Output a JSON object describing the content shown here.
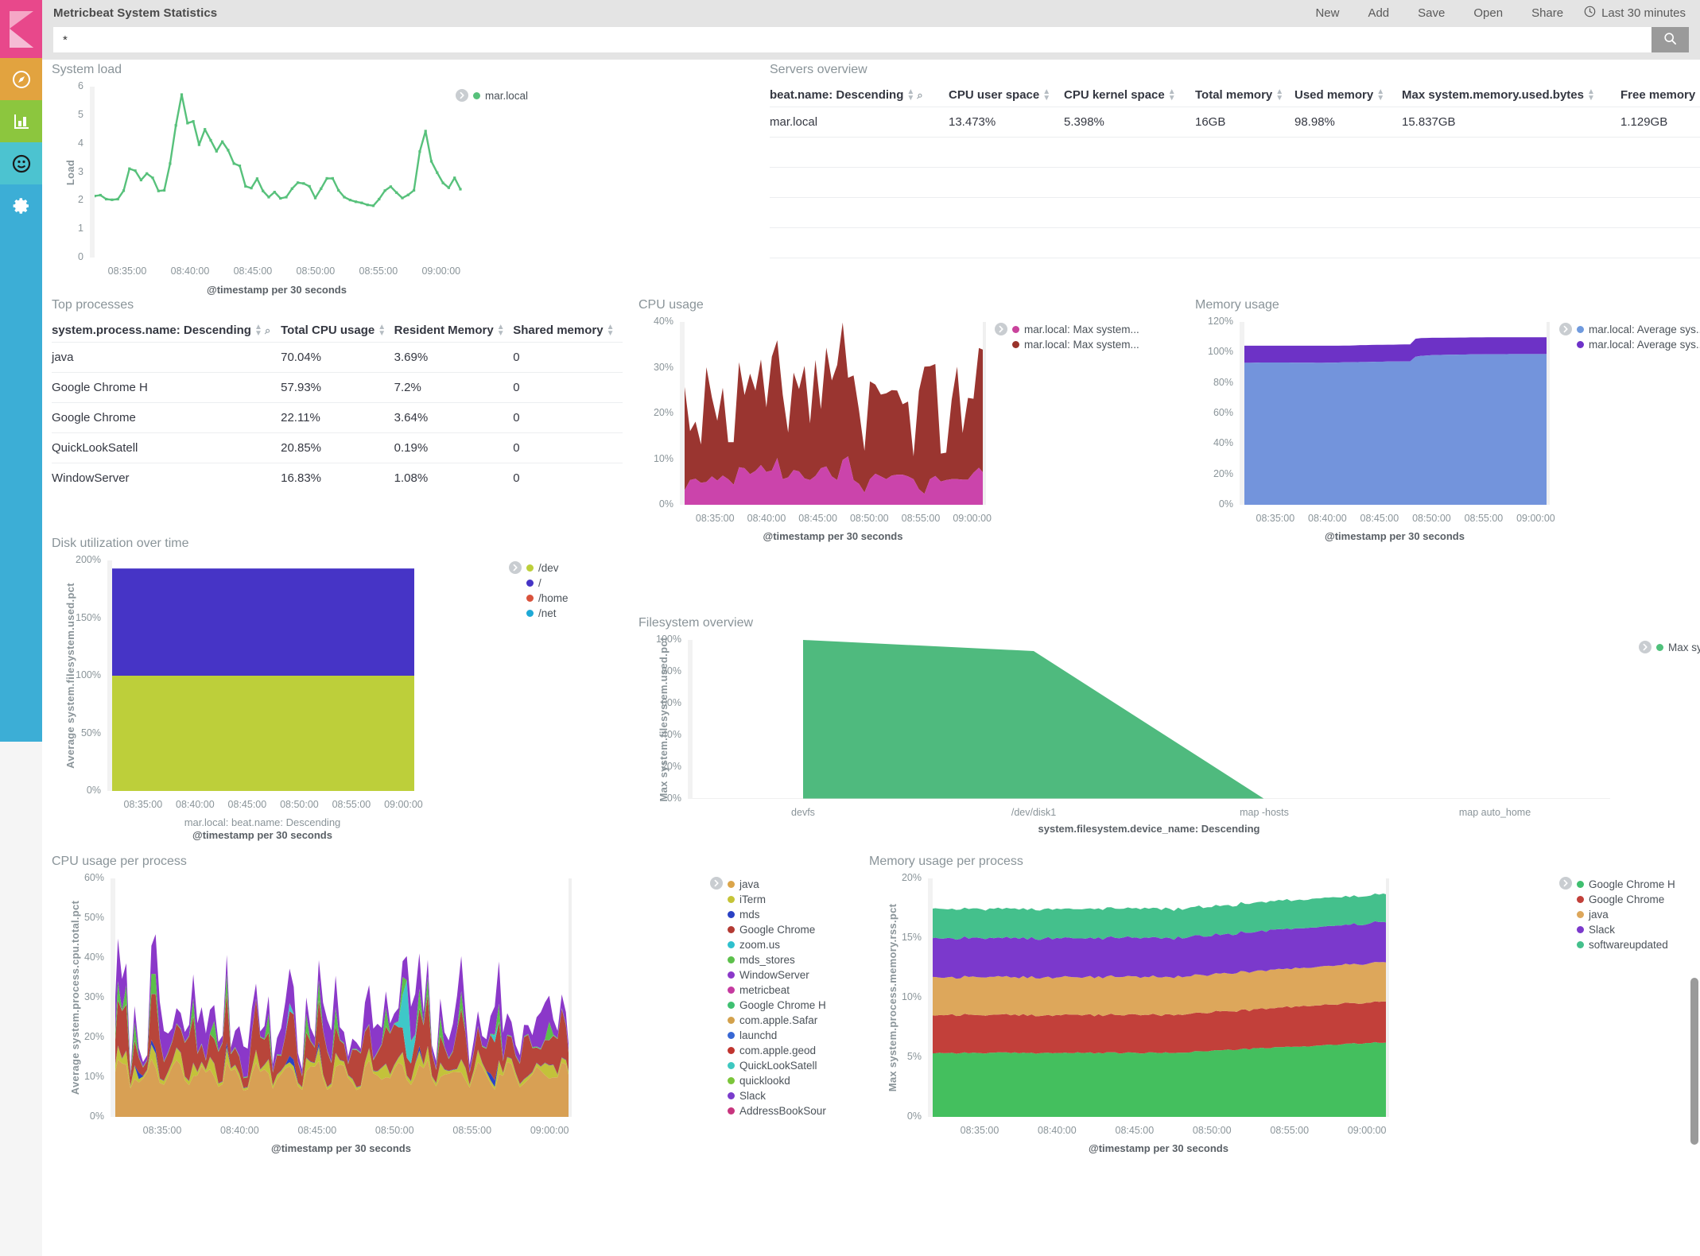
{
  "app": {
    "title": "Metricbeat System Statistics",
    "nav": [
      "New",
      "Add",
      "Save",
      "Open",
      "Share"
    ],
    "time_range": "Last 30 minutes",
    "clock_icon": "clock-icon",
    "search_icon": "search-icon"
  },
  "query": {
    "value": "*",
    "placeholder": ""
  },
  "sidebar": {
    "items": [
      {
        "name": "kibana-logo",
        "icon": "kibana-logo-icon",
        "color": "#e8488b"
      },
      {
        "name": "discover",
        "icon": "compass-icon",
        "color": "#e2a33f"
      },
      {
        "name": "visualize",
        "icon": "bar-chart-icon",
        "color": "#8cc63e"
      },
      {
        "name": "dashboard",
        "icon": "dashboard-icon",
        "color": "#4cc3d0"
      },
      {
        "name": "management",
        "icon": "gear-icon",
        "color": "#3caed6"
      }
    ]
  },
  "panels": {
    "system_load": {
      "title": "System load"
    },
    "servers_overview": {
      "title": "Servers overview"
    },
    "top_processes": {
      "title": "Top processes"
    },
    "cpu_usage": {
      "title": "CPU usage"
    },
    "memory_usage": {
      "title": "Memory usage"
    },
    "disk_utilization": {
      "title": "Disk utilization over time"
    },
    "filesystem_overview": {
      "title": "Filesystem overview"
    },
    "cpu_usage_per_process": {
      "title": "CPU usage per process"
    },
    "memory_usage_per_process": {
      "title": "Memory usage per process"
    }
  },
  "servers_table": {
    "columns": [
      "beat.name: Descending",
      "CPU user space",
      "CPU kernel space",
      "Total memory",
      "Used memory",
      "Max system.memory.used.bytes",
      "Free memory"
    ],
    "rows": [
      [
        "mar.local",
        "13.473%",
        "5.398%",
        "16GB",
        "98.98%",
        "15.837GB",
        "1.129GB"
      ]
    ],
    "empty_row_count": 5
  },
  "processes_table": {
    "columns": [
      "system.process.name: Descending",
      "Total CPU usage",
      "Resident Memory",
      "Shared memory"
    ],
    "rows": [
      [
        "java",
        "70.04%",
        "3.69%",
        "0"
      ],
      [
        "Google Chrome H",
        "57.93%",
        "7.2%",
        "0"
      ],
      [
        "Google Chrome",
        "22.11%",
        "3.64%",
        "0"
      ],
      [
        "QuickLookSatell",
        "20.85%",
        "0.19%",
        "0"
      ],
      [
        "WindowServer",
        "16.83%",
        "1.08%",
        "0"
      ]
    ]
  },
  "chart_data": [
    {
      "id": "system_load",
      "type": "line",
      "title": "System load",
      "xlabel": "@timestamp per 30 seconds",
      "ylabel": "Load",
      "ylim": [
        0,
        6
      ],
      "yticks": [
        "0",
        "1",
        "2",
        "3",
        "4",
        "5",
        "6"
      ],
      "xticks": [
        "08:35:00",
        "08:40:00",
        "08:45:00",
        "08:50:00",
        "08:55:00",
        "09:00:00"
      ],
      "legend": [
        {
          "name": "mar.local",
          "color": "#57c17b"
        }
      ],
      "series": [
        {
          "name": "mar.local",
          "color": "#57c17b",
          "values": [
            2.16,
            2.19,
            2.05,
            2.03,
            2.05,
            2.35,
            3.12,
            3.05,
            2.72,
            2.95,
            2.8,
            2.34,
            2.36,
            3.3,
            4.64,
            5.72,
            4.72,
            4.78,
            3.96,
            4.5,
            4.12,
            3.73,
            4.07,
            3.77,
            3.3,
            3.22,
            2.5,
            2.44,
            2.77,
            2.34,
            2.12,
            2.3,
            2.08,
            2.12,
            2.42,
            2.63,
            2.6,
            2.5,
            2.09,
            2.42,
            2.78,
            2.78,
            2.36,
            2.12,
            2.02,
            1.96,
            1.92,
            1.85,
            1.82,
            2.05,
            2.35,
            2.49,
            2.28,
            2.09,
            2.2,
            2.36,
            3.72,
            4.44,
            3.38,
            2.98,
            2.62,
            2.45,
            2.8,
            2.4
          ]
        }
      ]
    },
    {
      "id": "cpu_usage",
      "type": "area",
      "stacked": true,
      "title": "CPU usage",
      "xlabel": "@timestamp per 30 seconds",
      "ylabel": "",
      "ylim": [
        0,
        40
      ],
      "yticks": [
        "0%",
        "10%",
        "20%",
        "30%",
        "40%"
      ],
      "xticks": [
        "08:35:00",
        "08:40:00",
        "08:45:00",
        "08:50:00",
        "08:55:00",
        "09:00:00"
      ],
      "legend": [
        {
          "name": "mar.local: Max system...",
          "color": "#c9439c"
        },
        {
          "name": "mar.local: Max system...",
          "color": "#99322a"
        }
      ],
      "series": [
        {
          "name": "mar.local: Max system... (user)",
          "color": "#cb44ab",
          "values": [
            3.2,
            5.4,
            5.7,
            4.8,
            5.0,
            6.2,
            5.3,
            6.4,
            5.6,
            4.4,
            8.2,
            8.0,
            6.7,
            7.4,
            8.7,
            7.2,
            7.5,
            10.2,
            5.6,
            6.0,
            7.6,
            7.3,
            5.8,
            5.4,
            6.3,
            8.0,
            8.4,
            6.2,
            5.4,
            9.8,
            10.6,
            5.4,
            4.6,
            2.7,
            5.6,
            6.8,
            6.2,
            5.6,
            6.4,
            6.6,
            6.6,
            6.2,
            5.6,
            3.4,
            2.4,
            5.6,
            6.3,
            5.1,
            5.4,
            5.6,
            5.6,
            5.5,
            5.5,
            7.0,
            8.1,
            6.7
          ]
        },
        {
          "name": "mar.local: Max system... (kernel)",
          "color": "#9a3530",
          "values": [
            22.6,
            10.7,
            12.5,
            8.4,
            25.1,
            17.3,
            13.1,
            19.2,
            8.1,
            9.3,
            23.0,
            16.0,
            22.0,
            17.6,
            23.1,
            14.1,
            24.9,
            25.8,
            18.5,
            9.8,
            21.3,
            18.0,
            24.6,
            12.4,
            25.4,
            12.9,
            26.0,
            21.0,
            25.2,
            30.1,
            17.2,
            22.9,
            16.1,
            9.1,
            21.4,
            19.5,
            17.9,
            18.8,
            18.7,
            18.4,
            15.4,
            16.4,
            5.0,
            21.5,
            27.8,
            24.7,
            24.5,
            6.1,
            6.0,
            17.4,
            24.6,
            10.2,
            17.9,
            16.2,
            26.2,
            27.1
          ]
        }
      ]
    },
    {
      "id": "memory_usage",
      "type": "area",
      "stacked": true,
      "title": "Memory usage",
      "xlabel": "@timestamp per 30 seconds",
      "ylabel": "",
      "ylim": [
        0,
        120
      ],
      "yticks": [
        "0%",
        "20%",
        "40%",
        "60%",
        "80%",
        "100%",
        "120%"
      ],
      "xticks": [
        "08:35:00",
        "08:40:00",
        "08:45:00",
        "08:50:00",
        "08:55:00",
        "09:00:00"
      ],
      "legend": [
        {
          "name": "mar.local: Average sys...",
          "color": "#6f9ade"
        },
        {
          "name": "mar.local: Average sys...",
          "color": "#6e32c9"
        }
      ],
      "series": [
        {
          "name": "mar.local: Average sys... (used)",
          "color": "#7394dc",
          "values": [
            93.2,
            93.2,
            93.3,
            93.4,
            93.4,
            93.4,
            93.4,
            93.4,
            93.4,
            93.3,
            93.3,
            93.3,
            93.3,
            93.2,
            93.2,
            93.3,
            93.3,
            93.4,
            93.5,
            93.5,
            93.6,
            93.7,
            93.7,
            93.8,
            93.9,
            93.9,
            94.0,
            94.0,
            94.0,
            94.1,
            94.1,
            97.2,
            97.8,
            98.0,
            98.2,
            98.3,
            98.4,
            98.5,
            98.5,
            98.6,
            98.6,
            98.7,
            98.7,
            98.7,
            98.8,
            98.8,
            98.8,
            98.8,
            98.9,
            98.9,
            98.9,
            98.9,
            98.9,
            98.9,
            98.9,
            98.9
          ]
        },
        {
          "name": "mar.local: Average sys... (actual)",
          "color": "#6d32c6",
          "values": [
            11.2,
            11.2,
            11.1,
            11.0,
            11.0,
            11.0,
            11.0,
            11.0,
            11.0,
            11.1,
            11.1,
            11.1,
            11.1,
            11.2,
            11.2,
            11.1,
            11.1,
            11.0,
            11.0,
            11.0,
            11.0,
            11.1,
            11.1,
            11.1,
            11.1,
            11.1,
            11.1,
            11.1,
            11.2,
            11.2,
            11.2,
            11.8,
            11.6,
            11.5,
            11.4,
            11.3,
            11.2,
            11.2,
            11.2,
            11.2,
            11.2,
            11.2,
            11.2,
            11.2,
            11.2,
            11.2,
            11.2,
            11.2,
            11.1,
            11.1,
            11.1,
            11.1,
            11.1,
            11.1,
            11.1,
            11.1
          ]
        }
      ]
    },
    {
      "id": "disk_utilization",
      "type": "area",
      "stacked": true,
      "title": "Disk utilization over time",
      "xlabel": "@timestamp per 30 seconds",
      "xsublabel": "mar.local: beat.name: Descending",
      "ylabel": "Average system.filesystem.used.pct",
      "ylim": [
        0,
        200
      ],
      "yticks": [
        "0%",
        "50%",
        "100%",
        "150%",
        "200%"
      ],
      "xticks": [
        "08:35:00",
        "08:40:00",
        "08:45:00",
        "08:50:00",
        "08:55:00",
        "09:00:00"
      ],
      "legend": [
        {
          "name": "/dev",
          "color": "#bdcf3a"
        },
        {
          "name": "/",
          "color": "#4634c6"
        },
        {
          "name": "/home",
          "color": "#d9523c"
        },
        {
          "name": "/net",
          "color": "#1ea9d6"
        }
      ],
      "series": [
        {
          "name": "/dev",
          "color": "#bdcf3a",
          "constant": 100
        },
        {
          "name": "/",
          "color": "#4634c6",
          "constant": 93
        },
        {
          "name": "/home",
          "color": "#d9523c",
          "constant": 0
        },
        {
          "name": "/net",
          "color": "#1ea9d6",
          "constant": 0
        }
      ]
    },
    {
      "id": "filesystem_overview",
      "type": "area",
      "title": "Filesystem overview",
      "xlabel": "system.filesystem.device_name: Descending",
      "ylabel": "Max system.filesystem.used.pct",
      "ylim": [
        0,
        100
      ],
      "yticks": [
        "0%",
        "20%",
        "40%",
        "60%",
        "80%",
        "100%"
      ],
      "categories": [
        "devfs",
        "/dev/disk1",
        "map -hosts",
        "map auto_home"
      ],
      "legend": [
        {
          "name": "Max system.filesystem...",
          "color": "#4fc17b"
        }
      ],
      "series": [
        {
          "name": "Max system.filesystem...",
          "color": "#4fba7e",
          "values": [
            100,
            93,
            0,
            0
          ]
        }
      ]
    },
    {
      "id": "cpu_usage_per_process",
      "type": "area",
      "stacked": true,
      "title": "CPU usage per process",
      "xlabel": "@timestamp per 30 seconds",
      "ylabel": "Average system.process.cpu.total.pct",
      "ylim": [
        0,
        65
      ],
      "yticks": [
        "0%",
        "10%",
        "20%",
        "30%",
        "40%",
        "50%",
        "60%"
      ],
      "xticks": [
        "08:35:00",
        "08:40:00",
        "08:45:00",
        "08:50:00",
        "08:55:00",
        "09:00:00"
      ],
      "legend": [
        {
          "name": "java",
          "color": "#dba54a"
        },
        {
          "name": "iTerm",
          "color": "#c5c437"
        },
        {
          "name": "mds",
          "color": "#2a41c4"
        },
        {
          "name": "Google Chrome",
          "color": "#b33a33"
        },
        {
          "name": "zoom.us",
          "color": "#2fc0cd"
        },
        {
          "name": "mds_stores",
          "color": "#5cc04b"
        },
        {
          "name": "WindowServer",
          "color": "#8b38c9"
        },
        {
          "name": "metricbeat",
          "color": "#c53aa0"
        },
        {
          "name": "Google Chrome H",
          "color": "#3fc071"
        },
        {
          "name": "com.apple.Safar",
          "color": "#d3a14c"
        },
        {
          "name": "launchd",
          "color": "#3767d4"
        },
        {
          "name": "com.apple.geod",
          "color": "#c0352f"
        },
        {
          "name": "QuickLookSatell",
          "color": "#3ec8c0"
        },
        {
          "name": "quicklookd",
          "color": "#7bc53a"
        },
        {
          "name": "Slack",
          "color": "#7a3ccc"
        },
        {
          "name": "AddressBookSour",
          "color": "#c7357e"
        }
      ]
    },
    {
      "id": "memory_usage_per_process",
      "type": "area",
      "stacked": true,
      "title": "Memory usage per process",
      "xlabel": "@timestamp per 30 seconds",
      "ylabel": "Max system.process.memory.rss.pct",
      "ylim": [
        0,
        22
      ],
      "yticks": [
        "0%",
        "5%",
        "10%",
        "15%",
        "20%"
      ],
      "xticks": [
        "08:35:00",
        "08:40:00",
        "08:45:00",
        "08:50:00",
        "08:55:00",
        "09:00:00"
      ],
      "legend": [
        {
          "name": "Google Chrome H",
          "color": "#3fbf6f"
        },
        {
          "name": "Google Chrome",
          "color": "#c2403a"
        },
        {
          "name": "java",
          "color": "#dda75b"
        },
        {
          "name": "Slack",
          "color": "#7b39cc"
        },
        {
          "name": "softwareupdated",
          "color": "#44c08c"
        }
      ],
      "series": [
        {
          "name": "Google Chrome H",
          "color": "#44bf5e",
          "base": 5.9,
          "drift": 1.0
        },
        {
          "name": "Google Chrome",
          "color": "#c2403a",
          "base": 3.5,
          "drift": 0.3
        },
        {
          "name": "java",
          "color": "#dda75b",
          "base": 3.5,
          "drift": 0.1
        },
        {
          "name": "Slack",
          "color": "#7b39cc",
          "base": 3.6,
          "drift": 0.1
        },
        {
          "name": "softwareupdated",
          "color": "#44c08c",
          "base": 2.7,
          "drift": -0.1
        }
      ]
    }
  ]
}
